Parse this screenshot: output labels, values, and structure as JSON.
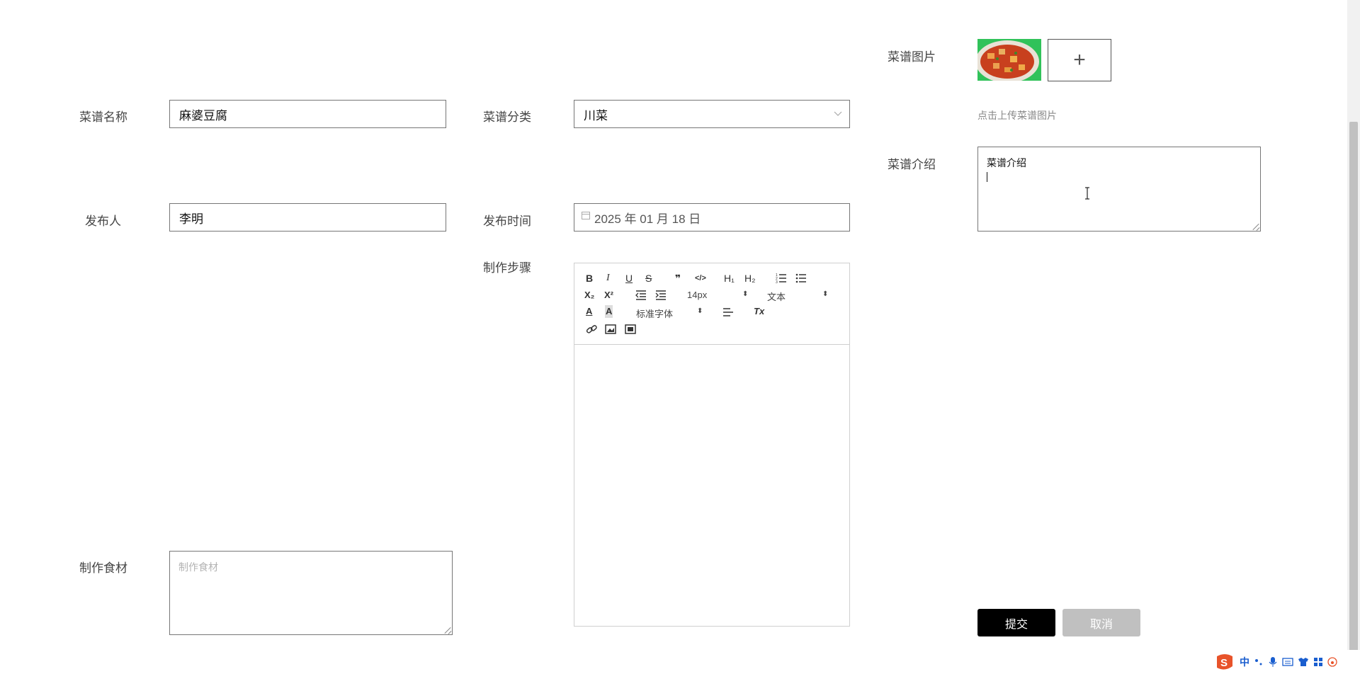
{
  "form": {
    "recipe_name": {
      "label": "菜谱名称",
      "value": "麻婆豆腐"
    },
    "category": {
      "label": "菜谱分类",
      "value": "川菜"
    },
    "publisher": {
      "label": "发布人",
      "value": "李明"
    },
    "publish_time": {
      "label": "发布时间",
      "value": "2025 年 01 月 18 日"
    },
    "steps": {
      "label": "制作步骤"
    },
    "ingredients": {
      "label": "制作食材",
      "placeholder": "制作食材"
    },
    "image": {
      "label": "菜谱图片",
      "hint": "点击上传菜谱图片",
      "add": "+"
    },
    "intro": {
      "label": "菜谱介绍",
      "value": "菜谱介绍"
    }
  },
  "editor": {
    "font_size": "14px",
    "block_type": "文本",
    "font_family": "标准字体",
    "buttons": {
      "bold": "B",
      "italic": "I",
      "underline": "U",
      "strike": "S",
      "quote": "❞",
      "code": "</>",
      "h1": "H₁",
      "h2": "H₂",
      "sub": "X₂",
      "sup": "X²",
      "clear": "Tx",
      "color": "A",
      "bg": "A"
    }
  },
  "actions": {
    "submit": "提交",
    "cancel": "取消"
  },
  "tray": {
    "ime": "中"
  }
}
